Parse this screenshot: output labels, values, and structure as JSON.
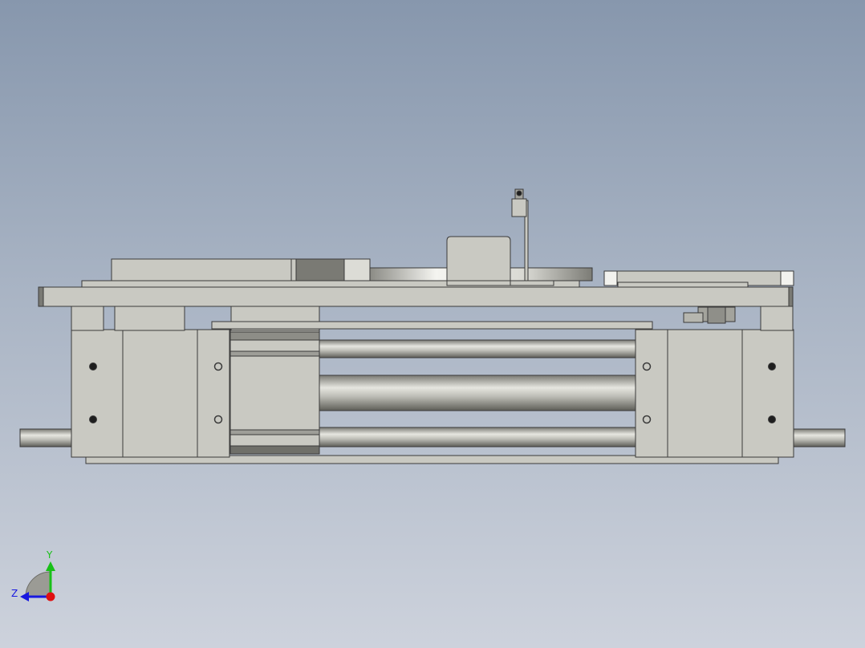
{
  "viewport": {
    "background_top": "#8797ad",
    "background_bottom": "#cdd2dc"
  },
  "model": {
    "part_fill": "#c9c9c2",
    "part_edge": "#3a3a3a",
    "shaft_light": "#e8e8e2",
    "shaft_dark": "#6e6e68",
    "hole_fill": "#1e1e1e"
  },
  "triad": {
    "y_label": "Y",
    "z_label": "Z",
    "x_color": "#e01010",
    "y_color": "#18c018",
    "z_color": "#1818e0"
  }
}
